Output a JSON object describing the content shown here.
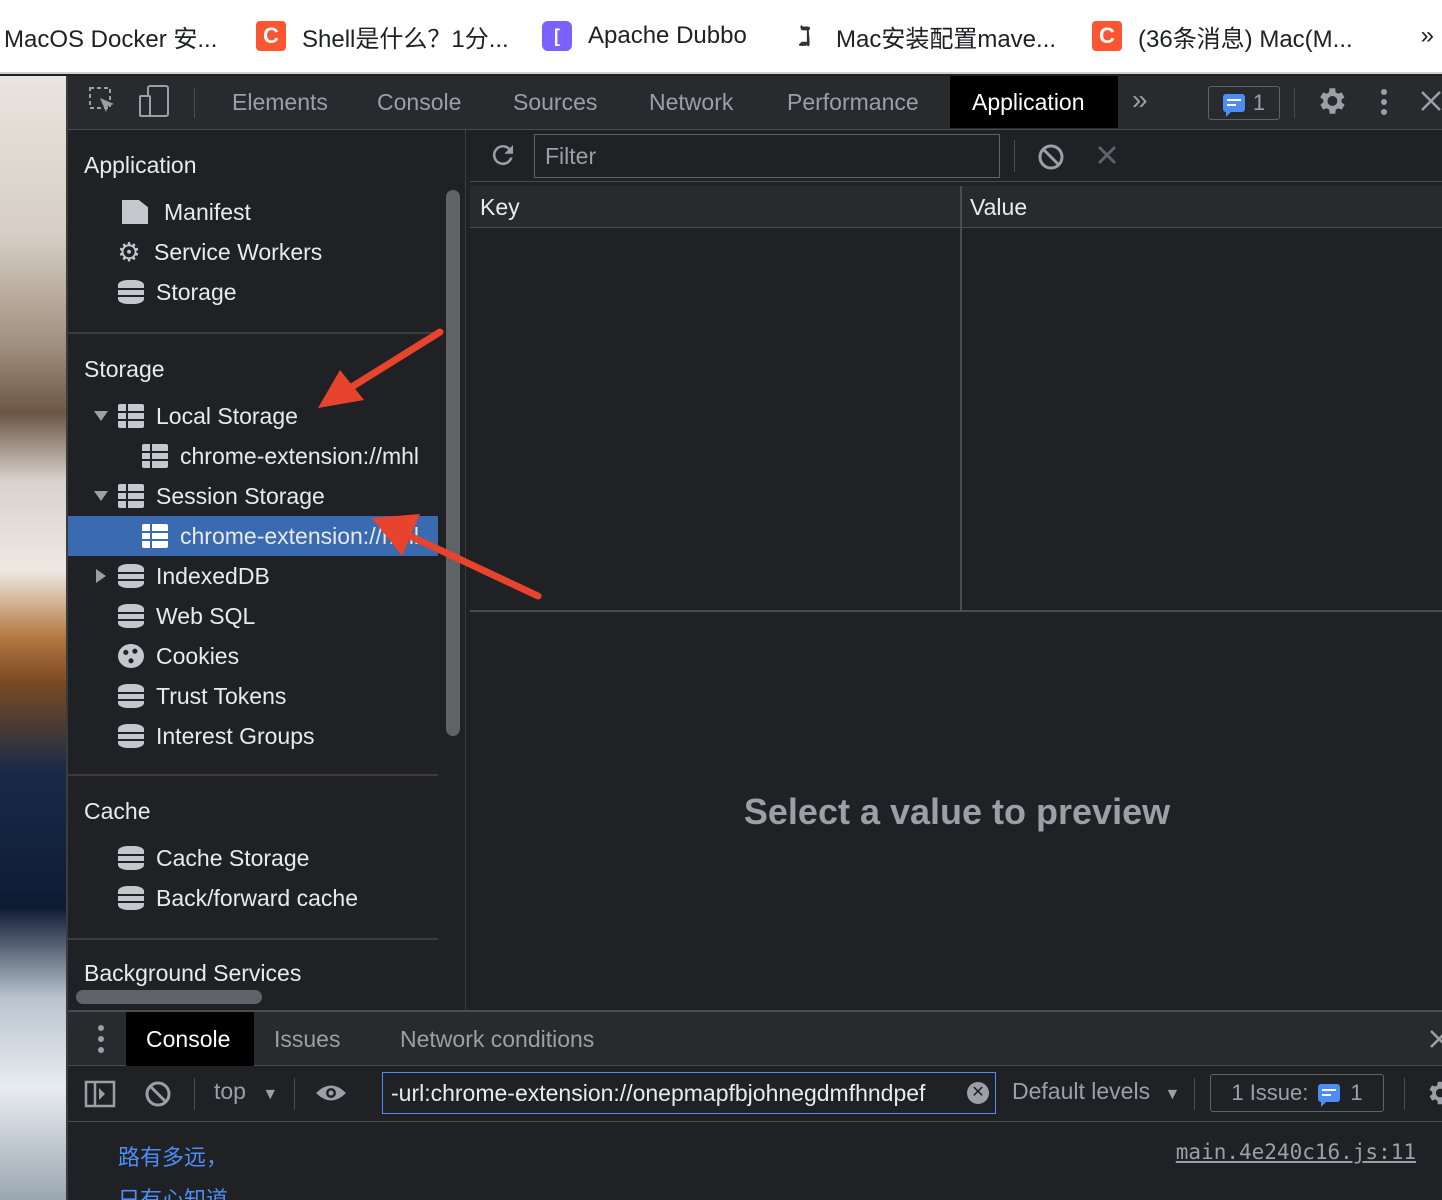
{
  "bookmarks": [
    {
      "label": "MacOS Docker 安...",
      "icon": "none"
    },
    {
      "label": "Shell是什么？1分...",
      "icon": "csdn-icon"
    },
    {
      "label": "Apache Dubbo",
      "icon": "dubbo-icon"
    },
    {
      "label": "Mac安装配置mave...",
      "icon": "maven-icon"
    },
    {
      "label": "(36条消息) Mac(M...",
      "icon": "csdn-icon"
    }
  ],
  "bookmarks_more": "»",
  "devtools": {
    "tabs": [
      "Elements",
      "Console",
      "Sources",
      "Network",
      "Performance",
      "Application"
    ],
    "active_tab": "Application",
    "more_tabs": "»",
    "issues_count": "1"
  },
  "sidebar": {
    "application_title": "Application",
    "application_items": [
      "Manifest",
      "Service Workers",
      "Storage"
    ],
    "storage_title": "Storage",
    "local_storage": "Local Storage",
    "local_storage_child": "chrome-extension://mhl",
    "session_storage": "Session Storage",
    "session_storage_child": "chrome-extension://mhl",
    "storage_items": [
      "IndexedDB",
      "Web SQL",
      "Cookies",
      "Trust Tokens",
      "Interest Groups"
    ],
    "cache_title": "Cache",
    "cache_items": [
      "Cache Storage",
      "Back/forward cache"
    ],
    "background_title": "Background Services"
  },
  "main": {
    "filter_placeholder": "Filter",
    "key_header": "Key",
    "value_header": "Value",
    "preview_text": "Select a value to preview"
  },
  "drawer": {
    "tabs": [
      "Console",
      "Issues",
      "Network conditions"
    ],
    "context": "top",
    "filter_value": "-url:chrome-extension://onepmapfbjohnegdmfhndpef",
    "levels": "Default levels",
    "issue_label": "1 Issue:",
    "issue_count": "1",
    "messages": [
      "路有多远，",
      "只有心知道"
    ],
    "source_link": "main.4e240c16.js:11"
  },
  "colors": {
    "accent_blue": "#4c8df6",
    "selection": "#3a6aaf",
    "annotation_arrow": "#e8432c",
    "panel_bg": "#202124"
  }
}
